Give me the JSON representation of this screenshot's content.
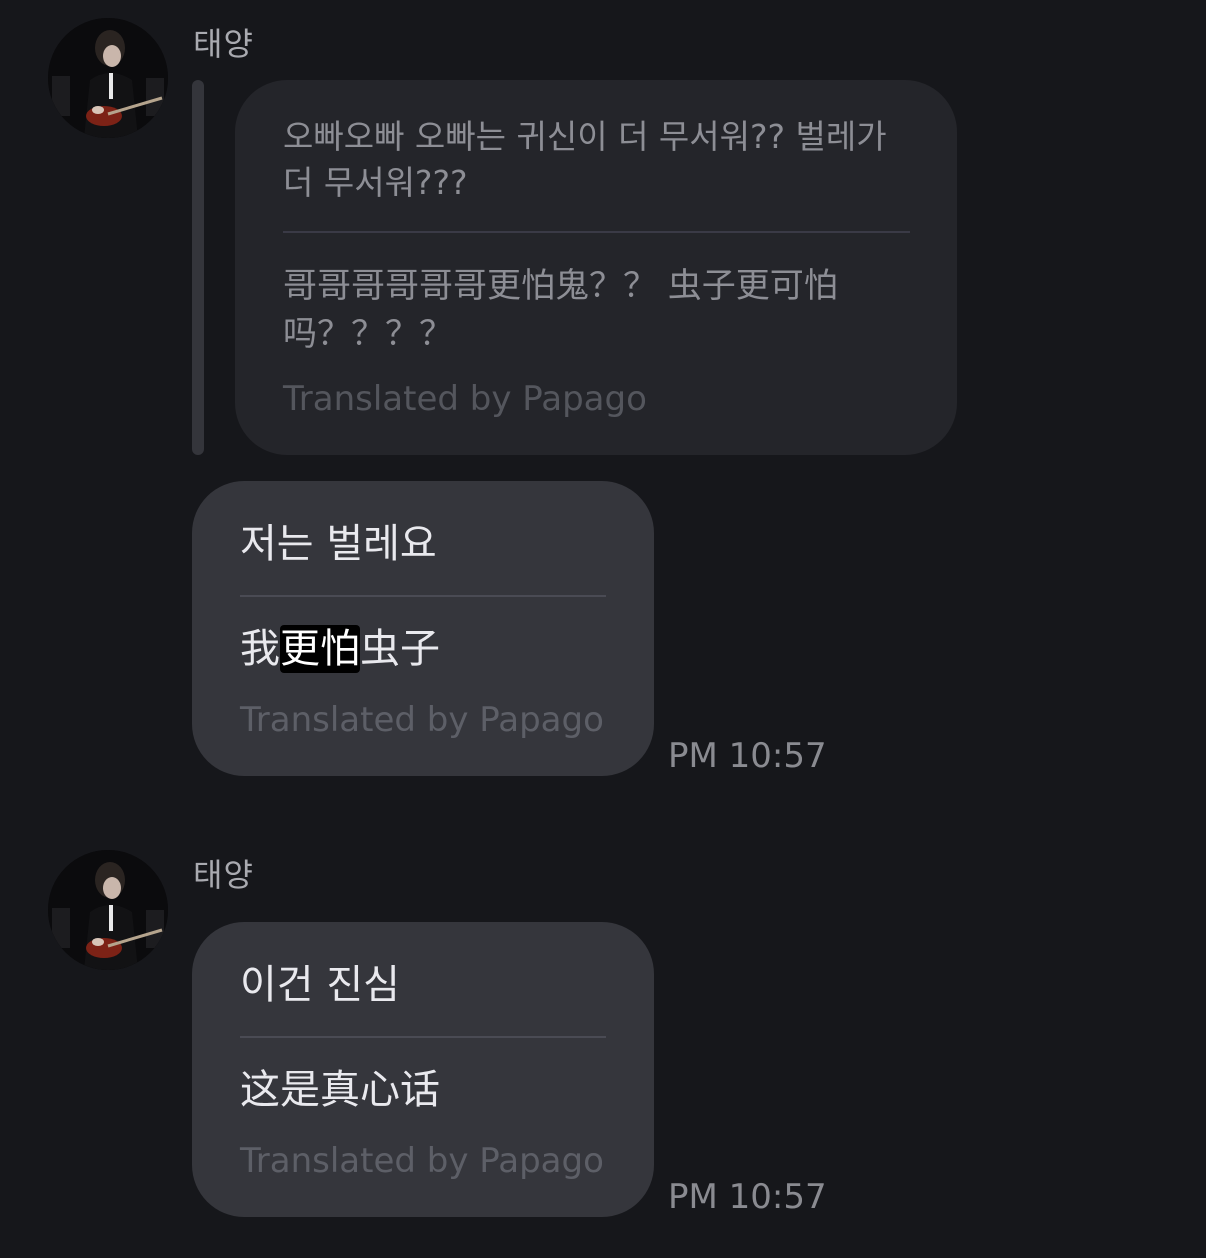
{
  "messages": [
    {
      "sender": "태양",
      "quote": {
        "original": "오빠오빠 오빠는 귀신이 더 무서워?? 벌레가 더 무서워???",
        "translated": "哥哥哥哥哥哥更怕鬼？？ 虫子更可怕吗？？？？",
        "credit": "Translated by Papago"
      },
      "original": "저는 벌레요",
      "translated_parts": [
        "我",
        "更怕",
        "虫子"
      ],
      "credit": "Translated by Papago",
      "time": "PM 10:57"
    },
    {
      "sender": "태양",
      "original": "이건 진심",
      "translated": "这是真心话",
      "credit": "Translated by Papago",
      "time": "PM 10:57"
    }
  ],
  "icons": {
    "avatar": "profile-photo-guitar"
  },
  "colors": {
    "background": "#16171b",
    "bubble": "#35363c",
    "quote_bubble": "#24252a",
    "highlight": "#000000"
  }
}
